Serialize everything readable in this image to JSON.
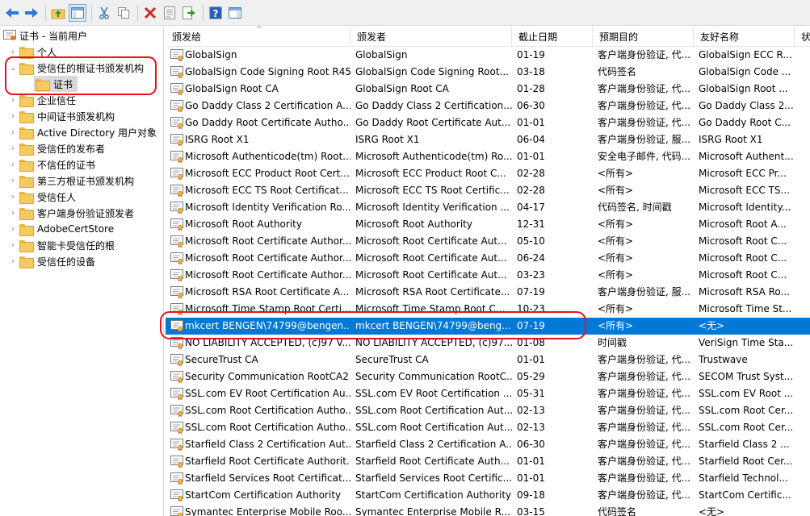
{
  "toolbar": {
    "buttons": [
      {
        "name": "back-arrow-icon"
      },
      {
        "name": "forward-arrow-icon"
      },
      {
        "name": "up-folder-icon"
      },
      {
        "name": "show-hide-tree-icon"
      },
      {
        "name": "cut-icon"
      },
      {
        "name": "copy-icon"
      },
      {
        "name": "delete-icon"
      },
      {
        "name": "properties-icon"
      },
      {
        "name": "export-list-icon"
      },
      {
        "name": "help-icon"
      },
      {
        "name": "action-pane-icon"
      }
    ]
  },
  "tree": {
    "root": "证书 - 当前用户",
    "items": [
      {
        "label": "个人"
      },
      {
        "label": "受信任的根证书颁发机构",
        "expanded": true
      },
      {
        "label": "证书",
        "child": true,
        "selected": true
      },
      {
        "label": "企业信任"
      },
      {
        "label": "中间证书颁发机构"
      },
      {
        "label": "Active Directory 用户对象"
      },
      {
        "label": "受信任的发布者"
      },
      {
        "label": "不信任的证书"
      },
      {
        "label": "第三方根证书颁发机构"
      },
      {
        "label": "受信任人"
      },
      {
        "label": "客户端身份验证颁发者"
      },
      {
        "label": "AdobeCertStore"
      },
      {
        "label": "智能卡受信任的根"
      },
      {
        "label": "受信任的设备"
      }
    ]
  },
  "columns": [
    "颁发给",
    "颁发者",
    "截止日期",
    "预期目的",
    "友好名称",
    "状"
  ],
  "rows": [
    [
      "GlobalSign",
      "GlobalSign",
      "01-19",
      "客户端身份验证, 代...",
      "GlobalSign ECC R..."
    ],
    [
      "GlobalSign Code Signing Root R45",
      "GlobalSign Code Signing Root...",
      "03-18",
      "代码签名",
      "GlobalSign Code ..."
    ],
    [
      "GlobalSign Root CA",
      "GlobalSign Root CA",
      "01-28",
      "客户端身份验证, 代...",
      "GlobalSign Root ..."
    ],
    [
      "Go Daddy Class 2 Certification A...",
      "Go Daddy Class 2 Certification...",
      "06-30",
      "客户端身份验证, 代...",
      "Go Daddy Class 2..."
    ],
    [
      "Go Daddy Root Certificate Autho...",
      "Go Daddy Root Certificate Aut...",
      "01-01",
      "客户端身份验证, 代...",
      "Go Daddy Root C..."
    ],
    [
      "ISRG Root X1",
      "ISRG Root X1",
      "06-04",
      "客户端身份验证, 服...",
      "ISRG Root X1"
    ],
    [
      "Microsoft Authenticode(tm) Root...",
      "Microsoft Authenticode(tm) Ro...",
      "01-01",
      "安全电子邮件, 代码...",
      "Microsoft Authent..."
    ],
    [
      "Microsoft ECC Product Root Cert...",
      "Microsoft ECC Product Root C...",
      "02-28",
      "<所有>",
      "Microsoft ECC Pr..."
    ],
    [
      "Microsoft ECC TS Root Certificat...",
      "Microsoft ECC TS Root Certific...",
      "02-28",
      "<所有>",
      "Microsoft ECC TS..."
    ],
    [
      "Microsoft Identity Verification Ro...",
      "Microsoft Identity Verification ...",
      "04-17",
      "代码签名, 时间戳",
      "Microsoft Identity..."
    ],
    [
      "Microsoft Root Authority",
      "Microsoft Root Authority",
      "12-31",
      "<所有>",
      "Microsoft Root A..."
    ],
    [
      "Microsoft Root Certificate Author...",
      "Microsoft Root Certificate Aut...",
      "05-10",
      "<所有>",
      "Microsoft Root C..."
    ],
    [
      "Microsoft Root Certificate Author...",
      "Microsoft Root Certificate Aut...",
      "06-24",
      "<所有>",
      "Microsoft Root C..."
    ],
    [
      "Microsoft Root Certificate Author...",
      "Microsoft Root Certificate Aut...",
      "03-23",
      "<所有>",
      "Microsoft Root C..."
    ],
    [
      "Microsoft RSA Root Certificate A...",
      "Microsoft RSA Root Certificate...",
      "07-19",
      "客户端身份验证, 服...",
      "Microsoft RSA Ro..."
    ],
    [
      "Microsoft Time Stamp Root Certi...",
      "Microsoft Time Stamp Root C...",
      "10-23",
      "<所有>",
      "Microsoft Time St..."
    ],
    [
      "mkcert BENGEN\\74799@bengen...",
      "mkcert BENGEN\\74799@beng...",
      "07-19",
      "<所有>",
      "<无>"
    ],
    [
      "NO LIABILITY ACCEPTED, (c)97 V...",
      "NO LIABILITY ACCEPTED, (c)97...",
      "01-08",
      "时间戳",
      "VeriSign Time Sta..."
    ],
    [
      "SecureTrust CA",
      "SecureTrust CA",
      "01-01",
      "客户端身份验证, 代...",
      "Trustwave"
    ],
    [
      "Security Communication RootCA2",
      "Security Communication RootC...",
      "05-29",
      "客户端身份验证, 代...",
      "SECOM Trust Syst..."
    ],
    [
      "SSL.com EV Root Certification Au...",
      "SSL.com EV Root Certification ...",
      "05-31",
      "客户端身份验证, 代...",
      "SSL.com EV Root ..."
    ],
    [
      "SSL.com Root Certification Autho...",
      "SSL.com Root Certification Aut...",
      "02-13",
      "客户端身份验证, 代...",
      "SSL.com Root Cer..."
    ],
    [
      "SSL.com Root Certification Autho...",
      "SSL.com Root Certification Aut...",
      "02-13",
      "客户端身份验证, 代...",
      "SSL.com Root Cer..."
    ],
    [
      "Starfield Class 2 Certification Aut...",
      "Starfield Class 2 Certification A...",
      "06-30",
      "客户端身份验证, 代...",
      "Starfield Class 2 ..."
    ],
    [
      "Starfield Root Certificate Authorit...",
      "Starfield Root Certificate Auth...",
      "01-01",
      "客户端身份验证, 代...",
      "Starfield Root Cer..."
    ],
    [
      "Starfield Services Root Certificat...",
      "Starfield Services Root Certific...",
      "01-01",
      "客户端身份验证, 代...",
      "Starfield Technol..."
    ],
    [
      "StartCom Certification Authority",
      "StartCom Certification Authority",
      "09-18",
      "客户端身份验证, 代...",
      "StartCom Certific..."
    ],
    [
      "Symantec Enterprise Mobile Roo...",
      "Symantec Enterprise Mobile R...",
      "03-15",
      "代码签名",
      "<无>"
    ]
  ],
  "selected_row_index": 16,
  "colors": {
    "selection": "#0078d7",
    "annotation_red": "#e8141c",
    "folder_yellow": "#f4cb5f"
  }
}
